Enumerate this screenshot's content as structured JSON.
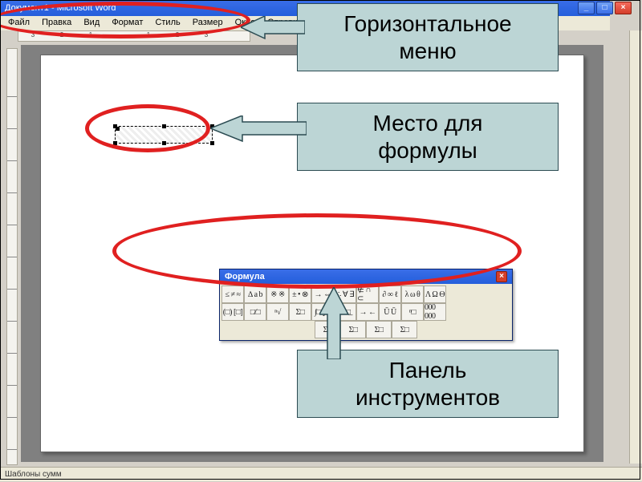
{
  "window": {
    "title": "Документ1 - Microsoft Word",
    "min": "_",
    "max": "□",
    "close": "×"
  },
  "menu": {
    "items": [
      "Файл",
      "Правка",
      "Вид",
      "Формат",
      "Стиль",
      "Размер",
      "Окно",
      "Справка"
    ]
  },
  "ruler_numbers": [
    "3",
    "2",
    "1",
    "",
    "1",
    "2",
    "3"
  ],
  "statusbar": {
    "text": "Шаблоны сумм"
  },
  "equation_toolbar": {
    "title": "Формула",
    "close": "×",
    "row1": [
      "≤ ≠ ≈",
      "∆ a b",
      "※ ※",
      "± • ⊗",
      "→ ⇔",
      "∴ ∀ ∃",
      "∉ ∩ ⊂",
      "∂ ∞ ℓ",
      "λ ω θ",
      "Λ Ω Θ"
    ],
    "row2": [
      "(□) [□]",
      "□⁄□",
      "ⁿ√",
      "Σ□",
      "∫□ ∮□",
      "□̄ □̲",
      "→ ←",
      "Ū Ū",
      "ⁿ□",
      "000\n000"
    ],
    "row3": [
      "Σ□",
      "Σ□",
      "Σ□",
      "Σ□"
    ]
  },
  "callouts": {
    "menu": {
      "line1": "Горизонтальное",
      "line2": "меню"
    },
    "formula": {
      "line1": "Место для",
      "line2": "формулы"
    },
    "toolbar": {
      "line1": "Панель",
      "line2": "инструментов"
    }
  }
}
